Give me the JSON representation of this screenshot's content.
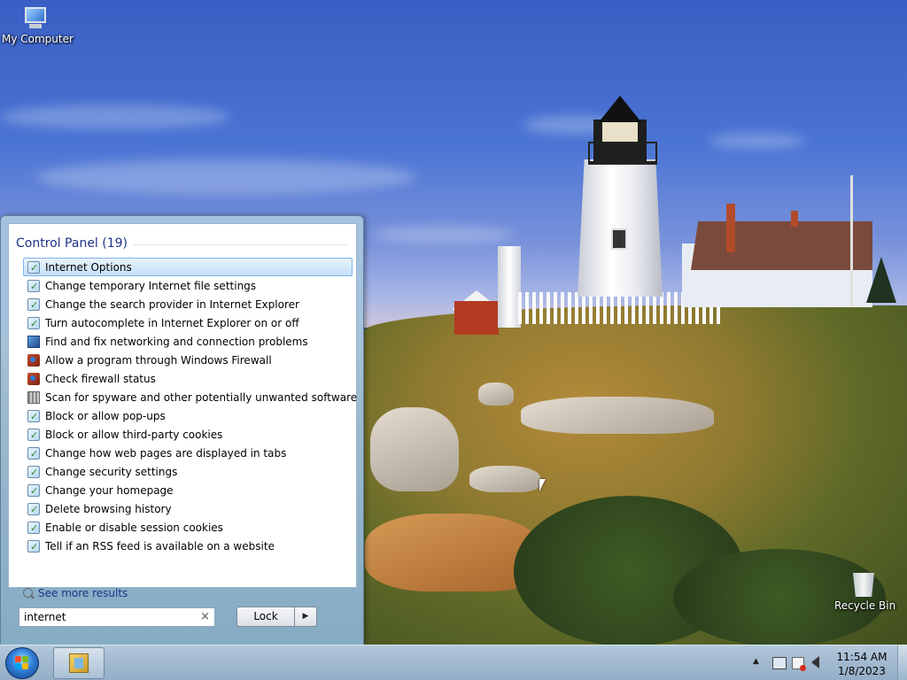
{
  "desktop": {
    "icons": [
      {
        "label": "My Computer",
        "icon": "computer-icon"
      },
      {
        "label": "Recycle Bin",
        "icon": "recycle-bin-icon"
      }
    ]
  },
  "start_menu": {
    "header": "Control Panel (19)",
    "results": [
      {
        "label": "Internet Options",
        "icon": "internet-options-icon",
        "selected": true
      },
      {
        "label": "Change temporary Internet file settings",
        "icon": "internet-options-icon"
      },
      {
        "label": "Change the search provider in Internet Explorer",
        "icon": "internet-options-icon"
      },
      {
        "label": "Turn autocomplete in Internet Explorer on or off",
        "icon": "internet-options-icon"
      },
      {
        "label": "Find and fix networking and connection problems",
        "icon": "network-icon"
      },
      {
        "label": "Allow a program through Windows Firewall",
        "icon": "firewall-icon"
      },
      {
        "label": "Check firewall status",
        "icon": "firewall-icon"
      },
      {
        "label": "Scan for spyware and other potentially unwanted software",
        "icon": "defender-icon"
      },
      {
        "label": "Block or allow pop-ups",
        "icon": "internet-options-icon"
      },
      {
        "label": "Block or allow third-party cookies",
        "icon": "internet-options-icon"
      },
      {
        "label": "Change how web pages are displayed in tabs",
        "icon": "internet-options-icon"
      },
      {
        "label": "Change security settings",
        "icon": "internet-options-icon"
      },
      {
        "label": "Change your homepage",
        "icon": "internet-options-icon"
      },
      {
        "label": "Delete browsing history",
        "icon": "internet-options-icon"
      },
      {
        "label": "Enable or disable session cookies",
        "icon": "internet-options-icon"
      },
      {
        "label": "Tell if an RSS feed is available on a website",
        "icon": "internet-options-icon"
      }
    ],
    "see_more": "See more results",
    "search": {
      "value": "internet",
      "clear_glyph": "×"
    },
    "power_button": {
      "label": "Lock",
      "arrow_glyph": "▶"
    }
  },
  "taskbar": {
    "tray": {
      "arrow_glyph": "▲",
      "icons": [
        "network-tray-icon",
        "action-center-icon",
        "volume-icon"
      ]
    },
    "clock": {
      "time": "11:54 AM",
      "date": "1/8/2023"
    }
  },
  "colors": {
    "taskbar": "#a3bad0",
    "start_menu_border": "#5f7d99",
    "header_text": "#1e3287",
    "selection": "#c5e0f8"
  }
}
